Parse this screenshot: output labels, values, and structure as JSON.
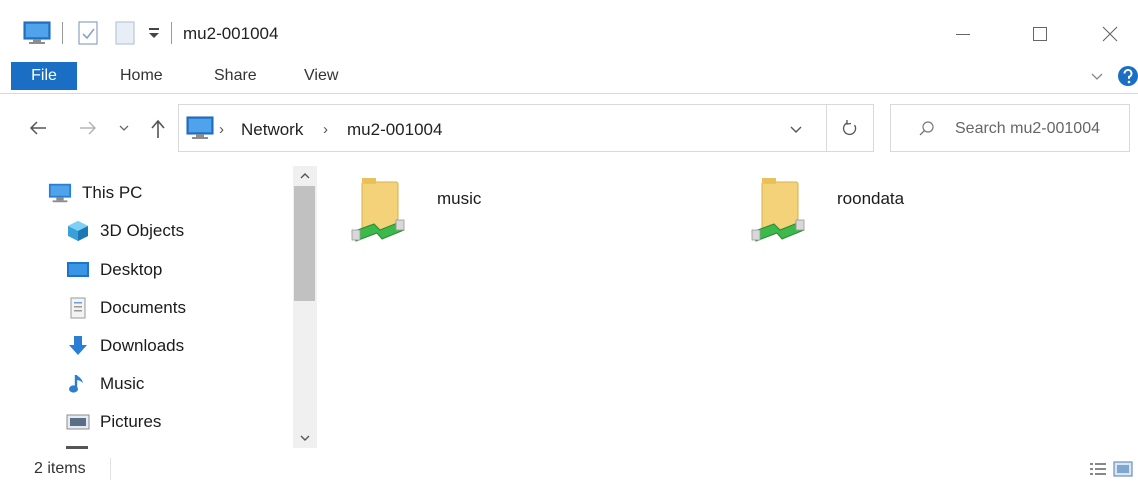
{
  "window": {
    "title": "mu2-001004"
  },
  "ribbon": {
    "tabs": [
      {
        "label": "File"
      },
      {
        "label": "Home"
      },
      {
        "label": "Share"
      },
      {
        "label": "View"
      }
    ]
  },
  "address": {
    "crumbs": [
      "Network",
      "mu2-001004"
    ]
  },
  "search": {
    "placeholder": "Search mu2-001004"
  },
  "sidebar": {
    "items": [
      {
        "label": "This PC",
        "icon": "this-pc-icon"
      },
      {
        "label": "3D Objects",
        "icon": "3d-objects-icon"
      },
      {
        "label": "Desktop",
        "icon": "desktop-icon"
      },
      {
        "label": "Documents",
        "icon": "documents-icon"
      },
      {
        "label": "Downloads",
        "icon": "downloads-icon"
      },
      {
        "label": "Music",
        "icon": "music-icon"
      },
      {
        "label": "Pictures",
        "icon": "pictures-icon"
      }
    ]
  },
  "content": {
    "items": [
      {
        "label": "music",
        "icon": "network-share-folder-icon"
      },
      {
        "label": "roondata",
        "icon": "network-share-folder-icon"
      }
    ]
  },
  "status": {
    "item_count": "2 items"
  },
  "colors": {
    "accent": "#1a6fc4",
    "folder": "#f4d27a",
    "share_link": "#3cb94a"
  }
}
